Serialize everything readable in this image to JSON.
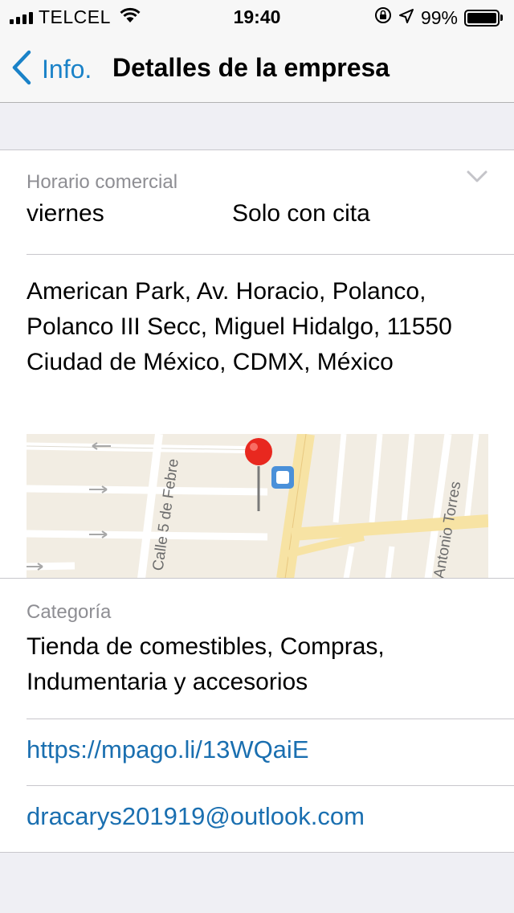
{
  "status_bar": {
    "carrier": "TELCEL",
    "time": "19:40",
    "battery": "99%",
    "battery_level": 0.99,
    "icons": [
      "signal-icon",
      "wifi-icon",
      "orientation-lock-icon",
      "location-icon",
      "battery-icon"
    ]
  },
  "nav": {
    "back_label": "Info.",
    "title": "Detalles de la empresa"
  },
  "details": {
    "hours_label": "Horario comercial",
    "hours_day": "viernes",
    "hours_value": "Solo con cita",
    "address": "American Park, Av. Horacio, Polanco, Polanco III Secc, Miguel Hidalgo, 11550 Ciudad de México, CDMX, México",
    "map_labels": {
      "street_1": "Calle 5 de Febre",
      "street_2": "Antonio Torres"
    },
    "category_label": "Categoría",
    "category_value": "Tienda de comestibles, Compras, Indumentaria y accesorios",
    "url": "https://mpago.li/13WQaiE",
    "email": "dracarys201919@outlook.com"
  },
  "colors": {
    "accent": "#1a82c8",
    "link": "#1a6fb0",
    "background": "#efeff4",
    "pin": "#e8281f"
  }
}
